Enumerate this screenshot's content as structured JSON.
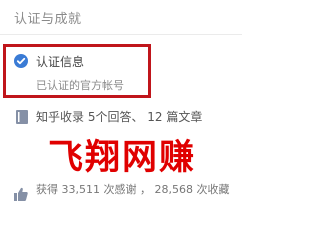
{
  "header": {
    "title": "认证与成就"
  },
  "verification": {
    "label": "认证信息",
    "subtitle": "已认证的官方帐号"
  },
  "zhihu": {
    "text": "知乎收录 5个回答、 12 篇文章"
  },
  "watermark": {
    "text": "飞翔网赚"
  },
  "stats": {
    "text": "获得 33,511 次感谢 ， 28,568 次收藏"
  },
  "colors": {
    "check_icon": "#3a7bd5",
    "highlight_border": "#c0151b",
    "watermark": "#e00000",
    "icon_gray": "#8590a6"
  },
  "icons": [
    "check-badge-icon",
    "book-icon",
    "thumbs-up-icon"
  ]
}
